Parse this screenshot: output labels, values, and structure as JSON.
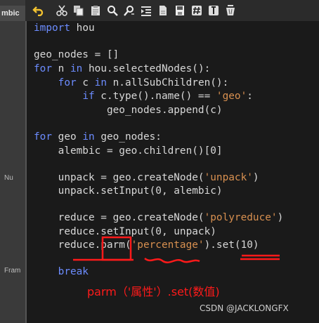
{
  "left_panel": {
    "tab_label": "mbic",
    "labels": [
      "Nu",
      "Fram"
    ]
  },
  "toolbar": {
    "icons": [
      "undo-icon",
      "cut-icon",
      "copy-icon",
      "paste-icon",
      "search-icon",
      "replace-icon",
      "indent-icon",
      "file-icon",
      "save-icon",
      "comment-icon",
      "uncomment-icon",
      "clear-icon"
    ]
  },
  "code": {
    "lines": [
      "import hou",
      "",
      "geo_nodes = []",
      "for n in hou.selectedNodes():",
      "    for c in n.allSubChildren():",
      "        if c.type().name() == 'geo':",
      "            geo_nodes.append(c)",
      "",
      "for geo in geo_nodes:",
      "    alembic = geo.children()[0]",
      "",
      "    unpack = geo.createNode('unpack')",
      "    unpack.setInput(0, alembic)",
      "",
      "    reduce = geo.createNode('polyreduce')",
      "    reduce.setInput(0, unpack)",
      "    reduce.parm('percentage').set(10)",
      "",
      "    break"
    ]
  },
  "annotation": {
    "caption": "parm（'属性'）.set(数值)",
    "color": "#ff1a1a"
  },
  "watermark": "CSDN @JACKLONGFX",
  "colors": {
    "keyword": "#6c8cff",
    "string": "#d89050",
    "text": "#d8d8d8",
    "background": "#1a1a1a"
  }
}
